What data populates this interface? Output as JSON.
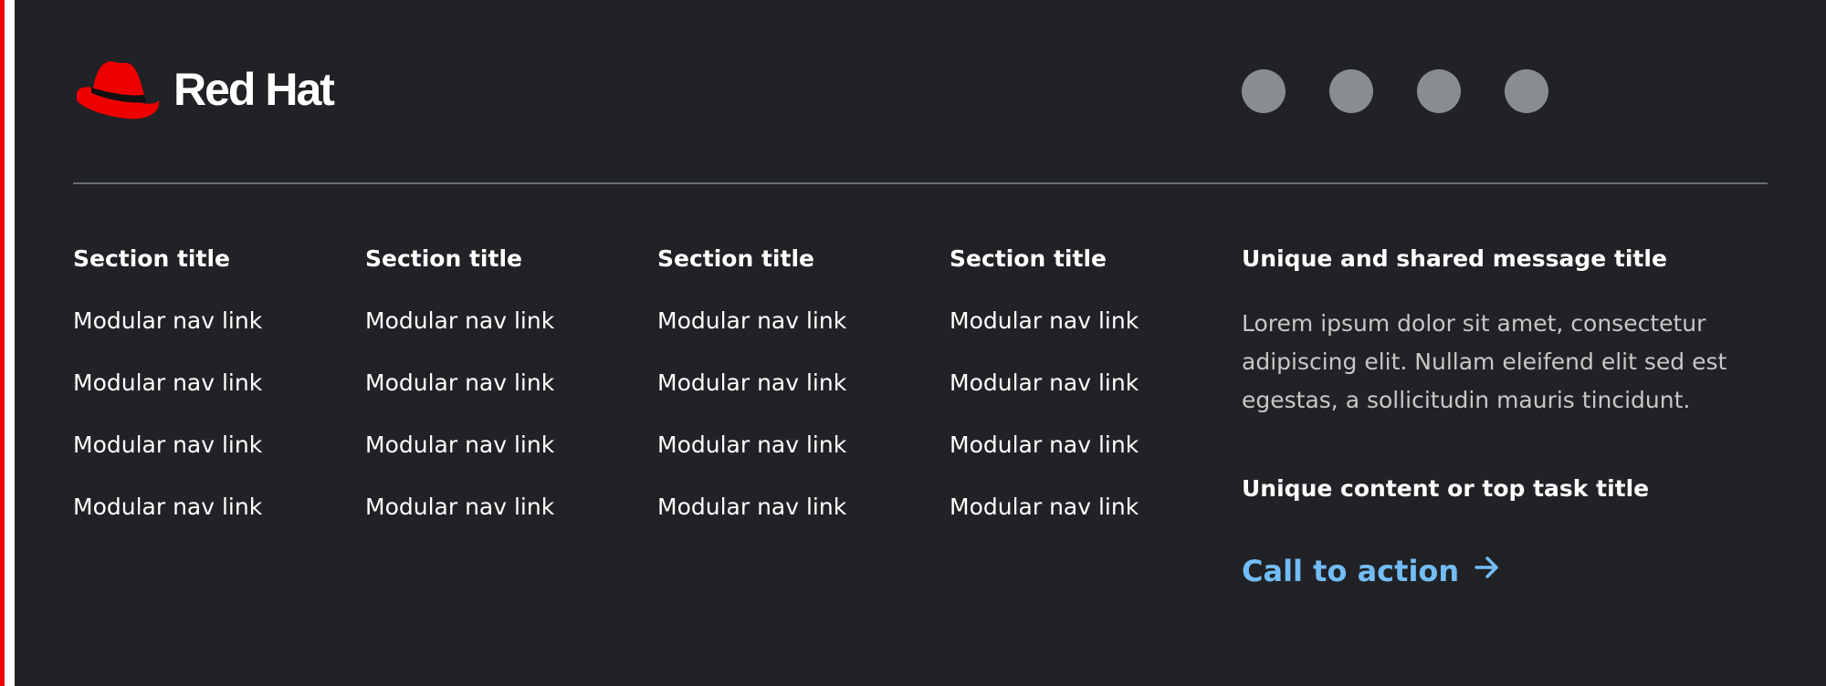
{
  "brand": {
    "name": "Red Hat",
    "accent_color": "#ee0000",
    "logo_icon": "fedora-hat-icon"
  },
  "social": {
    "items": [
      {
        "icon": "social-icon-1"
      },
      {
        "icon": "social-icon-2"
      },
      {
        "icon": "social-icon-3"
      },
      {
        "icon": "social-icon-4"
      }
    ],
    "color": "#8a8d90"
  },
  "nav": {
    "columns": [
      {
        "title": "Section title",
        "links": [
          "Modular nav link",
          "Modular nav link",
          "Modular nav link",
          "Modular nav link"
        ]
      },
      {
        "title": "Section title",
        "links": [
          "Modular nav link",
          "Modular nav link",
          "Modular nav link",
          "Modular nav link"
        ]
      },
      {
        "title": "Section title",
        "links": [
          "Modular nav link",
          "Modular nav link",
          "Modular nav link",
          "Modular nav link"
        ]
      },
      {
        "title": "Section title",
        "links": [
          "Modular nav link",
          "Modular nav link",
          "Modular nav link",
          "Modular nav link"
        ]
      }
    ]
  },
  "message": {
    "title": "Unique and shared message title",
    "body": "Lorem ipsum dolor sit amet, consectetur adipiscing elit. Nullam eleifend elit sed est egestas, a sollicitudin mauris tincidunt.",
    "task_title": "Unique content or top task title",
    "cta_label": "Call to action",
    "cta_icon": "arrow-right-icon",
    "cta_color": "#73bcf7"
  },
  "colors": {
    "background": "#202225",
    "divider": "#6a6e73",
    "body_text": "#c7c7c7"
  }
}
